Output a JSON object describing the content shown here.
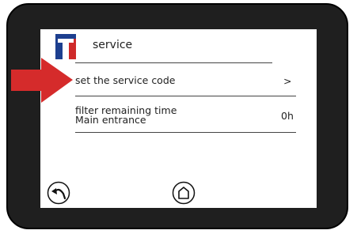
{
  "header": {
    "title": "service"
  },
  "menu": {
    "items": [
      {
        "label": "set the service code",
        "value": ">"
      },
      {
        "label_line1": "filter remaining time",
        "label_line2": "Main entrance",
        "value": "0h"
      }
    ]
  },
  "footer": {
    "back_icon": "back-arrow-icon",
    "home_icon": "home-icon"
  },
  "colors": {
    "bezel": "#1f1f1f",
    "pointer_arrow": "#d52b2b",
    "logo_blue": "#1d3f8f",
    "logo_red": "#cf2a2a"
  }
}
